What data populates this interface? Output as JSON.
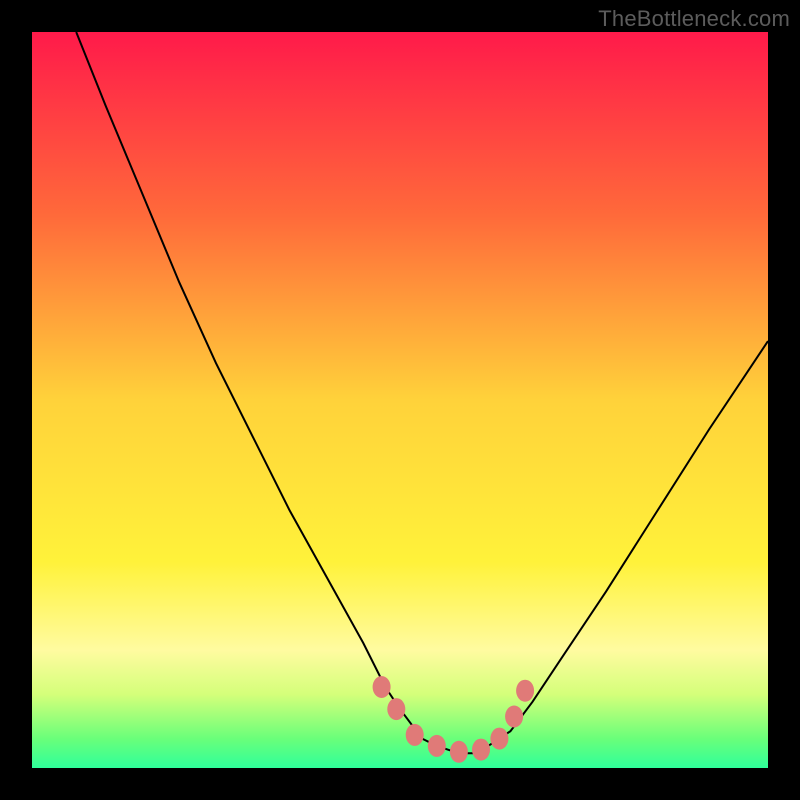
{
  "watermark": "TheBottleneck.com",
  "colors": {
    "frame": "#000000",
    "watermark": "#5c5c5c",
    "gradient_stops": [
      {
        "offset": 0,
        "color": "#ff1a4a"
      },
      {
        "offset": 25,
        "color": "#ff6a3a"
      },
      {
        "offset": 50,
        "color": "#ffd23a"
      },
      {
        "offset": 72,
        "color": "#fff23a"
      },
      {
        "offset": 84,
        "color": "#fffba0"
      },
      {
        "offset": 90,
        "color": "#d4ff7a"
      },
      {
        "offset": 96,
        "color": "#6aff7a"
      },
      {
        "offset": 100,
        "color": "#2fff9a"
      }
    ],
    "curve": "#000000",
    "marker_fill": "#e07a78",
    "marker_stroke": "#c86860"
  },
  "chart_data": {
    "type": "line",
    "title": "",
    "xlabel": "",
    "ylabel": "",
    "x_range": [
      0,
      100
    ],
    "y_range": [
      0,
      100
    ],
    "note": "y-axis inverted visually (0 at bottom = green/good, 100 at top = red/bad). Curve is a V-shape indicating bottleneck severity vs. some component ratio; optimal near x≈58 where y≈2.",
    "series": [
      {
        "name": "bottleneck-curve",
        "x": [
          6,
          10,
          15,
          20,
          25,
          30,
          35,
          40,
          45,
          48,
          50,
          53,
          55,
          58,
          60,
          62,
          65,
          68,
          72,
          78,
          85,
          92,
          100
        ],
        "y": [
          100,
          90,
          78,
          66,
          55,
          45,
          35,
          26,
          17,
          11,
          8,
          4,
          3,
          2,
          2,
          3,
          5,
          9,
          15,
          24,
          35,
          46,
          58
        ]
      }
    ],
    "markers": {
      "name": "highlighted-points",
      "x": [
        47.5,
        49.5,
        52,
        55,
        58,
        61,
        63.5,
        65.5,
        67
      ],
      "y": [
        11,
        8,
        4.5,
        3,
        2.2,
        2.5,
        4,
        7,
        10.5
      ]
    }
  }
}
